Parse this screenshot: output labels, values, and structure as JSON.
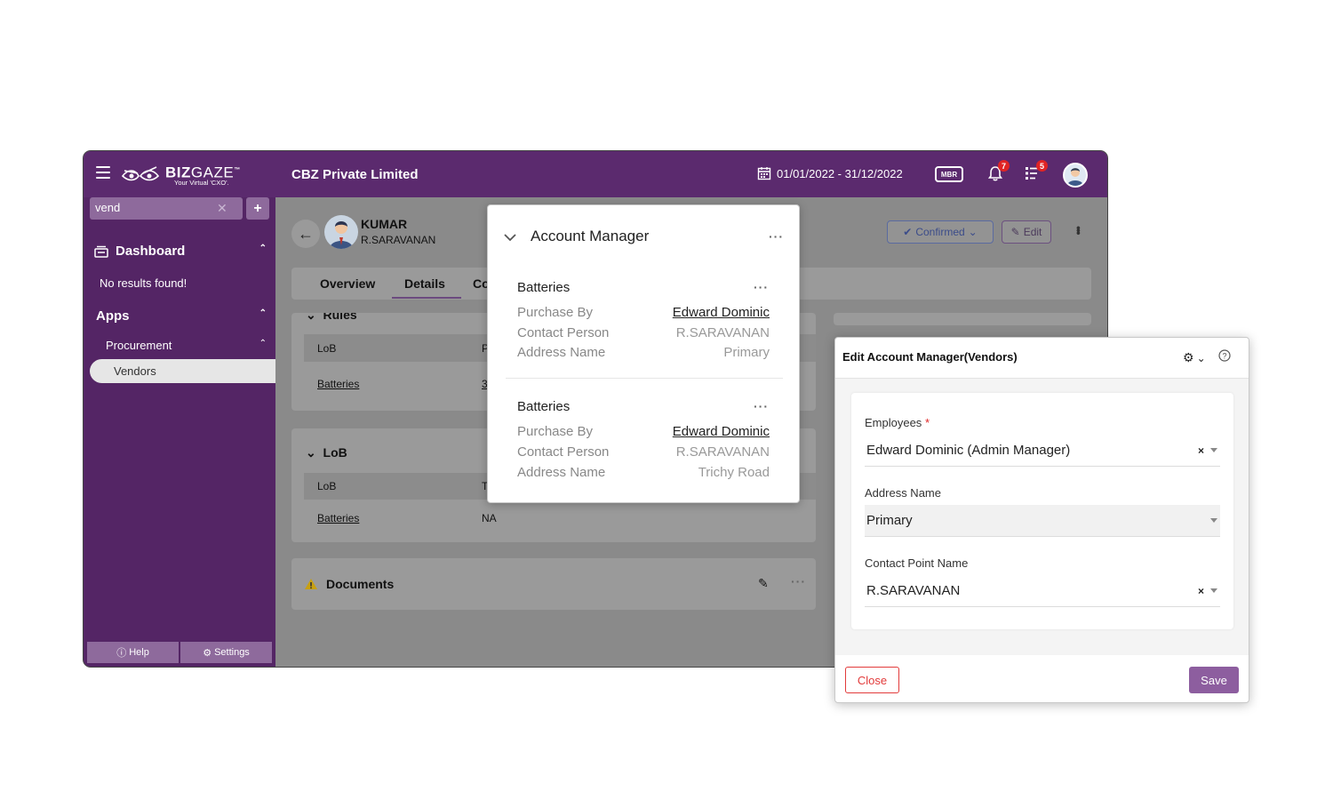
{
  "topbar": {
    "logo_text_bold": "BIZ",
    "logo_text_light": "GAZE",
    "logo_tm": "™",
    "logo_tagline": "Your Virtual 'CXO'.",
    "company": "CBZ Private Limited",
    "date_range": "01/01/2022 - 31/12/2022",
    "mbr_label": "MBR",
    "notifications_count": "7",
    "tasks_count": "5"
  },
  "sidebar": {
    "search_value": "vend",
    "add_label": "+",
    "dashboard_label": "Dashboard",
    "no_results": "No results found!",
    "apps_label": "Apps",
    "procurement_label": "Procurement",
    "vendors_label": "Vendors",
    "help_label": "Help",
    "settings_label": "Settings"
  },
  "vendor": {
    "name": "KUMAR",
    "contact": "R.SARAVANAN",
    "status": "Confirmed",
    "edit_label": "Edit"
  },
  "tabs": [
    "Overview",
    "Details",
    "Co"
  ],
  "rules_section": {
    "title": "Rules",
    "header_col1": "LoB",
    "header_col2": "P",
    "row_col1": "Batteries",
    "row_col2": "3"
  },
  "lob_section": {
    "title": "LoB",
    "header_col1": "LoB",
    "header_col2": "T",
    "row_col1": "Batteries",
    "row_col2": "NA"
  },
  "documents_section": {
    "title": "Documents"
  },
  "account_manager_popup": {
    "title": "Account Manager",
    "items": [
      {
        "title": "Batteries",
        "purchase_by_label": "Purchase By",
        "purchase_by": "Edward Dominic",
        "contact_person_label": "Contact Person",
        "contact_person": "R.SARAVANAN",
        "address_name_label": "Address Name",
        "address_name": "Primary"
      },
      {
        "title": "Batteries",
        "purchase_by_label": "Purchase By",
        "purchase_by": "Edward Dominic",
        "contact_person_label": "Contact Person",
        "contact_person": "R.SARAVANAN",
        "address_name_label": "Address Name",
        "address_name": "Trichy Road"
      }
    ]
  },
  "edit_modal": {
    "title": "Edit Account Manager(Vendors)",
    "employees_label": "Employees",
    "required_mark": "*",
    "employees_value": "Edward Dominic (Admin Manager)",
    "address_label": "Address Name",
    "address_value": "Primary",
    "contact_label": "Contact Point Name",
    "contact_value": "R.SARAVANAN",
    "clear_glyph": "×",
    "close_label": "Close",
    "save_label": "Save"
  },
  "colors": {
    "brand_purple": "#5b2a6e",
    "sidebar_purple": "#542565",
    "save_purple": "#8d5e9f",
    "close_red": "#e23b3b",
    "badge_red": "#e02424"
  }
}
